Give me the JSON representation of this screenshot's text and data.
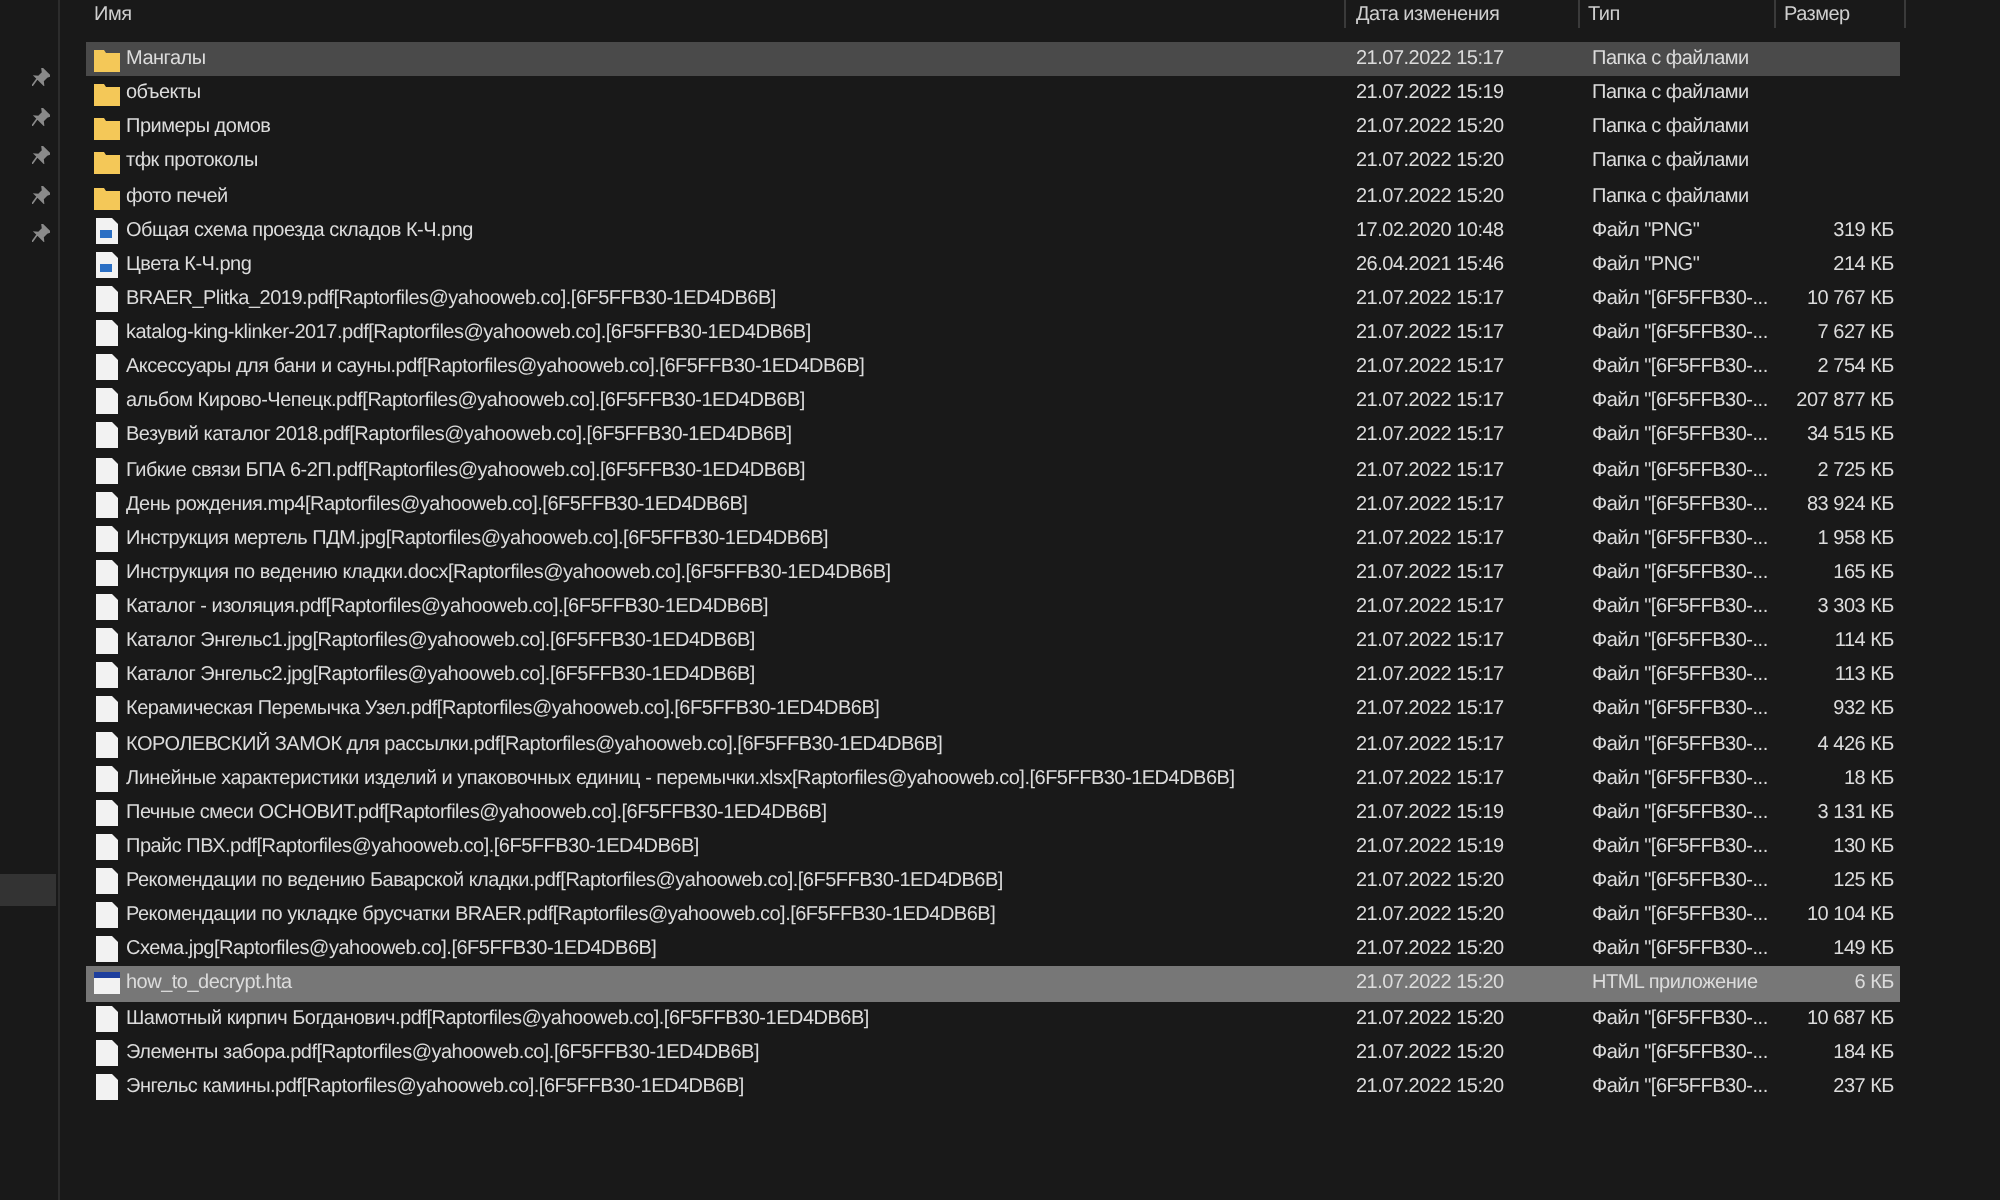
{
  "columns": [
    "Имя",
    "Дата изменения",
    "Тип",
    "Размер"
  ],
  "rows": [
    {
      "kind": "folder",
      "name": "Мангалы",
      "date": "21.07.2022 15:17",
      "type": "Папка с файлами",
      "hovered": true,
      "selected": false
    },
    {
      "kind": "folder",
      "name": "объекты",
      "date": "21.07.2022 15:19",
      "type": "Папка с файлами",
      "hovered": false,
      "selected": false
    },
    {
      "kind": "folder",
      "name": "Примеры домов",
      "date": "21.07.2022 15:20",
      "type": "Папка с файлами",
      "hovered": false,
      "selected": false
    },
    {
      "kind": "folder",
      "name": "тфк протоколы",
      "date": "21.07.2022 15:20",
      "type": "Папка с файлами",
      "hovered": false,
      "selected": false
    },
    {
      "kind": "folder",
      "name": "фото печей",
      "date": "21.07.2022 15:20",
      "type": "Папка с файлами",
      "hovered": false,
      "selected": false
    },
    {
      "kind": "image",
      "name": "Общая схема проезда складов К-Ч.png",
      "date": "17.02.2020 10:48",
      "type": "Файл \"PNG\"",
      "size": "319 КБ",
      "hovered": false,
      "selected": false
    },
    {
      "kind": "image",
      "name": "Цвета К-Ч.png",
      "date": "26.04.2021 15:46",
      "type": "Файл \"PNG\"",
      "size": "214 КБ",
      "hovered": false,
      "selected": false
    },
    {
      "kind": "file",
      "name": "BRAER_Plitka_2019.pdf[Raptorfiles@yahooweb.co].[6F5FFB30-1ED4DB6B]",
      "date": "21.07.2022 15:17",
      "type": "Файл \"[6F5FFB30-...",
      "size": "10 767 КБ",
      "hovered": false,
      "selected": false
    },
    {
      "kind": "file",
      "name": "katalog-king-klinker-2017.pdf[Raptorfiles@yahooweb.co].[6F5FFB30-1ED4DB6B]",
      "date": "21.07.2022 15:17",
      "type": "Файл \"[6F5FFB30-...",
      "size": "7 627 КБ",
      "hovered": false,
      "selected": false
    },
    {
      "kind": "file",
      "name": "Аксессуары для бани и сауны.pdf[Raptorfiles@yahooweb.co].[6F5FFB30-1ED4DB6B]",
      "date": "21.07.2022 15:17",
      "type": "Файл \"[6F5FFB30-...",
      "size": "2 754 КБ",
      "hovered": false,
      "selected": false
    },
    {
      "kind": "file",
      "name": "альбом Кирово-Чепецк.pdf[Raptorfiles@yahooweb.co].[6F5FFB30-1ED4DB6B]",
      "date": "21.07.2022 15:17",
      "type": "Файл \"[6F5FFB30-...",
      "size": "207 877 КБ",
      "hovered": false,
      "selected": false
    },
    {
      "kind": "file",
      "name": "Везувий каталог 2018.pdf[Raptorfiles@yahooweb.co].[6F5FFB30-1ED4DB6B]",
      "date": "21.07.2022 15:17",
      "type": "Файл \"[6F5FFB30-...",
      "size": "34 515 КБ",
      "hovered": false,
      "selected": false
    },
    {
      "kind": "file",
      "name": "Гибкие связи БПА 6-2П.pdf[Raptorfiles@yahooweb.co].[6F5FFB30-1ED4DB6B]",
      "date": "21.07.2022 15:17",
      "type": "Файл \"[6F5FFB30-...",
      "size": "2 725 КБ",
      "hovered": false,
      "selected": false
    },
    {
      "kind": "file",
      "name": "День рождения.mp4[Raptorfiles@yahooweb.co].[6F5FFB30-1ED4DB6B]",
      "date": "21.07.2022 15:17",
      "type": "Файл \"[6F5FFB30-...",
      "size": "83 924 КБ",
      "hovered": false,
      "selected": false
    },
    {
      "kind": "file",
      "name": "Инструкция мертель ПДМ.jpg[Raptorfiles@yahooweb.co].[6F5FFB30-1ED4DB6B]",
      "date": "21.07.2022 15:17",
      "type": "Файл \"[6F5FFB30-...",
      "size": "1 958 КБ",
      "hovered": false,
      "selected": false
    },
    {
      "kind": "file",
      "name": "Инструкция по ведению кладки.docx[Raptorfiles@yahooweb.co].[6F5FFB30-1ED4DB6B]",
      "date": "21.07.2022 15:17",
      "type": "Файл \"[6F5FFB30-...",
      "size": "165 КБ",
      "hovered": false,
      "selected": false
    },
    {
      "kind": "file",
      "name": "Каталог - изоляция.pdf[Raptorfiles@yahooweb.co].[6F5FFB30-1ED4DB6B]",
      "date": "21.07.2022 15:17",
      "type": "Файл \"[6F5FFB30-...",
      "size": "3 303 КБ",
      "hovered": false,
      "selected": false
    },
    {
      "kind": "file",
      "name": "Каталог Энгельс1.jpg[Raptorfiles@yahooweb.co].[6F5FFB30-1ED4DB6B]",
      "date": "21.07.2022 15:17",
      "type": "Файл \"[6F5FFB30-...",
      "size": "114 КБ",
      "hovered": false,
      "selected": false
    },
    {
      "kind": "file",
      "name": "Каталог Энгельс2.jpg[Raptorfiles@yahooweb.co].[6F5FFB30-1ED4DB6B]",
      "date": "21.07.2022 15:17",
      "type": "Файл \"[6F5FFB30-...",
      "size": "113 КБ",
      "hovered": false,
      "selected": false
    },
    {
      "kind": "file",
      "name": "Керамическая Перемычка Узел.pdf[Raptorfiles@yahooweb.co].[6F5FFB30-1ED4DB6B]",
      "date": "21.07.2022 15:17",
      "type": "Файл \"[6F5FFB30-...",
      "size": "932 КБ",
      "hovered": false,
      "selected": false
    },
    {
      "kind": "file",
      "name": "КОРОЛЕВСКИЙ ЗАМОК для рассылки.pdf[Raptorfiles@yahooweb.co].[6F5FFB30-1ED4DB6B]",
      "date": "21.07.2022 15:17",
      "type": "Файл \"[6F5FFB30-...",
      "size": "4 426 КБ",
      "hovered": false,
      "selected": false
    },
    {
      "kind": "file",
      "name": "Линейные характеристики изделий и упаковочных единиц - перемычки.xlsx[Raptorfiles@yahooweb.co].[6F5FFB30-1ED4DB6B]",
      "date": "21.07.2022 15:17",
      "type": "Файл \"[6F5FFB30-...",
      "size": "18 КБ",
      "hovered": false,
      "selected": false
    },
    {
      "kind": "file",
      "name": "Печные смеси ОСНОВИТ.pdf[Raptorfiles@yahooweb.co].[6F5FFB30-1ED4DB6B]",
      "date": "21.07.2022 15:19",
      "type": "Файл \"[6F5FFB30-...",
      "size": "3 131 КБ",
      "hovered": false,
      "selected": false
    },
    {
      "kind": "file",
      "name": "Прайс ПВХ.pdf[Raptorfiles@yahooweb.co].[6F5FFB30-1ED4DB6B]",
      "date": "21.07.2022 15:19",
      "type": "Файл \"[6F5FFB30-...",
      "size": "130 КБ",
      "hovered": false,
      "selected": false
    },
    {
      "kind": "file",
      "name": "Рекомендации по ведению Баварской кладки.pdf[Raptorfiles@yahooweb.co].[6F5FFB30-1ED4DB6B]",
      "date": "21.07.2022 15:20",
      "type": "Файл \"[6F5FFB30-...",
      "size": "125 КБ",
      "hovered": false,
      "selected": false
    },
    {
      "kind": "file",
      "name": "Рекомендации по укладке брусчатки BRAER.pdf[Raptorfiles@yahooweb.co].[6F5FFB30-1ED4DB6B]",
      "date": "21.07.2022 15:20",
      "type": "Файл \"[6F5FFB30-...",
      "size": "10 104 КБ",
      "hovered": false,
      "selected": false
    },
    {
      "kind": "file",
      "name": "Схема.jpg[Raptorfiles@yahooweb.co].[6F5FFB30-1ED4DB6B]",
      "date": "21.07.2022 15:20",
      "type": "Файл \"[6F5FFB30-...",
      "size": "149 КБ",
      "hovered": false,
      "selected": false
    },
    {
      "kind": "app",
      "name": "how_to_decrypt.hta",
      "date": "21.07.2022 15:20",
      "type": "HTML приложение",
      "size": "6 КБ",
      "hovered": false,
      "selected": true
    },
    {
      "kind": "file",
      "name": "Шамотный кирпич Богданович.pdf[Raptorfiles@yahooweb.co].[6F5FFB30-1ED4DB6B]",
      "date": "21.07.2022 15:20",
      "type": "Файл \"[6F5FFB30-...",
      "size": "10 687 КБ",
      "hovered": false,
      "selected": false
    },
    {
      "kind": "file",
      "name": "Элементы забора.pdf[Raptorfiles@yahooweb.co].[6F5FFB30-1ED4DB6B]",
      "date": "21.07.2022 15:20",
      "type": "Файл \"[6F5FFB30-...",
      "size": "184 КБ",
      "hovered": false,
      "selected": false
    },
    {
      "kind": "file",
      "name": "Энгельс камины.pdf[Raptorfiles@yahooweb.co].[6F5FFB30-1ED4DB6B]",
      "date": "21.07.2022 15:20",
      "type": "Файл \"[6F5FFB30-...",
      "size": "237 КБ",
      "hovered": false,
      "selected": false
    }
  ]
}
